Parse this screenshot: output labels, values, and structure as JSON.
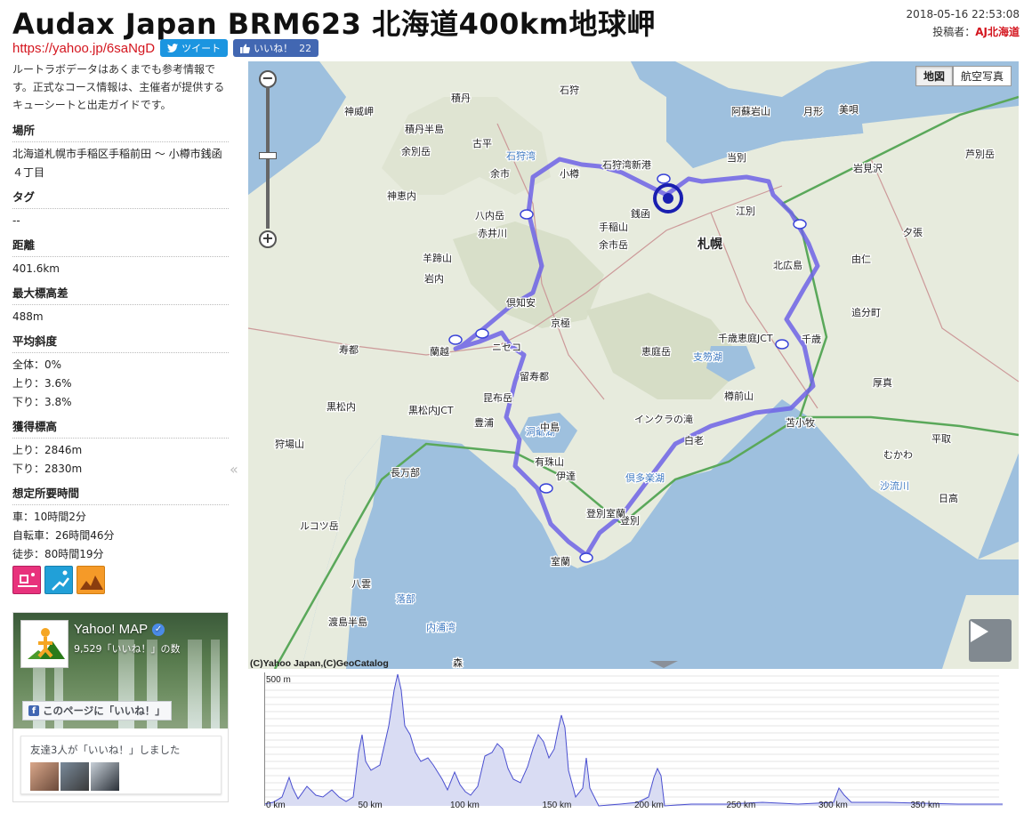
{
  "header": {
    "title": "Audax Japan BRM623 北海道400km地球岬",
    "datetime": "2018-05-16 22:53:08",
    "author_label": "投稿者：",
    "author": "AJ北海道",
    "short_url": "https://yahoo.jp/6saNgD",
    "tweet_label": "ツイート",
    "like_label": "いいね！",
    "like_count": "22"
  },
  "sidebar": {
    "note": "ルートラボデータはあくまでも参考情報です。正式なコース情報は、主催者が提供するキューシートと出走ガイドです。",
    "place_h": "場所",
    "place_v": "北海道札幌市手稲区手稲前田 ～ 小樽市銭函４丁目",
    "tag_h": "タグ",
    "tag_v": "--",
    "dist_h": "距離",
    "dist_v": "401.6km",
    "maxdiff_h": "最大標高差",
    "maxdiff_v": "488m",
    "slope_h": "平均斜度",
    "slope_all": "全体：0%",
    "slope_up": "上り：3.6%",
    "slope_down": "下り：3.8%",
    "gain_h": "獲得標高",
    "gain_up": "上り：2846m",
    "gain_down": "下り：2830m",
    "time_h": "想定所要時間",
    "time_car": "車：10時間2分",
    "time_bike": "自転車：26時間46分",
    "time_walk": "徒歩：80時間19分"
  },
  "facebook": {
    "page_name": "Yahoo! MAP",
    "page_likes": "9,529「いいね！」の数",
    "like_button": "このページに「いいね！」",
    "friends": "友達3人が「いいね！」しました"
  },
  "map": {
    "type_map": "地図",
    "type_aerial": "航空写真",
    "copyright": "(C)Yahoo Japan,(C)GeoCatalog",
    "labels": [
      {
        "t": "神威岬",
        "k": "s"
      },
      {
        "t": "積丹",
        "k": "s"
      },
      {
        "t": "積丹半島",
        "k": "s"
      },
      {
        "t": "古平",
        "k": "s"
      },
      {
        "t": "石狩湾",
        "k": "w"
      },
      {
        "t": "余別岳",
        "k": "s"
      },
      {
        "t": "余市",
        "k": "s"
      },
      {
        "t": "小樽",
        "k": "s"
      },
      {
        "t": "石狩湾新港",
        "k": "s"
      },
      {
        "t": "神恵内",
        "k": "s"
      },
      {
        "t": "八内岳",
        "k": "s"
      },
      {
        "t": "赤井川",
        "k": "s"
      },
      {
        "t": "銭函",
        "k": "s"
      },
      {
        "t": "手稲山",
        "k": "s"
      },
      {
        "t": "札幌",
        "k": "b"
      },
      {
        "t": "余市岳",
        "k": "s"
      },
      {
        "t": "江別",
        "k": "s"
      },
      {
        "t": "北広島",
        "k": "s"
      },
      {
        "t": "岩内",
        "k": "s"
      },
      {
        "t": "倶知安",
        "k": "s"
      },
      {
        "t": "京極",
        "k": "s"
      },
      {
        "t": "ニセコ",
        "k": "s"
      },
      {
        "t": "蘭越",
        "k": "s"
      },
      {
        "t": "寿都",
        "k": "s"
      },
      {
        "t": "留寿都",
        "k": "s"
      },
      {
        "t": "恵庭岳",
        "k": "s"
      },
      {
        "t": "支笏湖",
        "k": "w"
      },
      {
        "t": "千歳",
        "k": "s"
      },
      {
        "t": "千歳恵庭JCT",
        "k": "s"
      },
      {
        "t": "樽前山",
        "k": "s"
      },
      {
        "t": "黒松内",
        "k": "s"
      },
      {
        "t": "黒松内JCT",
        "k": "s"
      },
      {
        "t": "昆布岳",
        "k": "s"
      },
      {
        "t": "豊浦",
        "k": "s"
      },
      {
        "t": "洞爺湖",
        "k": "w"
      },
      {
        "t": "有珠山",
        "k": "s"
      },
      {
        "t": "伊達",
        "k": "s"
      },
      {
        "t": "インクラの滝",
        "k": "s"
      },
      {
        "t": "苫小牧",
        "k": "s"
      },
      {
        "t": "白老",
        "k": "s"
      },
      {
        "t": "登別",
        "k": "s"
      },
      {
        "t": "室蘭",
        "k": "s"
      },
      {
        "t": "長万部",
        "k": "s"
      },
      {
        "t": "八雲",
        "k": "s"
      },
      {
        "t": "厚真",
        "k": "s"
      },
      {
        "t": "むかわ",
        "k": "s"
      },
      {
        "t": "夕張",
        "k": "s"
      },
      {
        "t": "由仁",
        "k": "s"
      },
      {
        "t": "追分町",
        "k": "s"
      },
      {
        "t": "岩見沢",
        "k": "s"
      },
      {
        "t": "当別",
        "k": "s"
      },
      {
        "t": "美唄",
        "k": "s"
      },
      {
        "t": "阿蘇岩山",
        "k": "s"
      },
      {
        "t": "月形",
        "k": "s"
      },
      {
        "t": "芦別岳",
        "k": "s"
      },
      {
        "t": "平取",
        "k": "s"
      },
      {
        "t": "日高",
        "k": "s"
      },
      {
        "t": "沙流川",
        "k": "w"
      },
      {
        "t": "倶多楽湖",
        "k": "w"
      },
      {
        "t": "登別室蘭",
        "k": "s"
      },
      {
        "t": "渡島半島",
        "k": "s"
      },
      {
        "t": "内浦湾",
        "k": "w"
      },
      {
        "t": "石狩",
        "k": "s"
      },
      {
        "t": "中島",
        "k": "s"
      },
      {
        "t": "羊蹄山",
        "k": "s"
      },
      {
        "t": "狩場山",
        "k": "s"
      },
      {
        "t": "ルコツ岳",
        "k": "s"
      },
      {
        "t": "森",
        "k": "s"
      },
      {
        "t": "落部",
        "k": "w"
      }
    ]
  },
  "elevation": {
    "y_label": "500 m",
    "x_ticks": [
      "0 km",
      "50 km",
      "100 km",
      "150 km",
      "200 km",
      "250 km",
      "300 km",
      "350 km"
    ]
  },
  "colors": {
    "route": "#6d63e6",
    "red_accent": "#d4161f",
    "tweet": "#1b95e0",
    "fb": "#4267b2",
    "elev_line": "#4a4fd0",
    "elev_fill": "#d9dcf3"
  }
}
